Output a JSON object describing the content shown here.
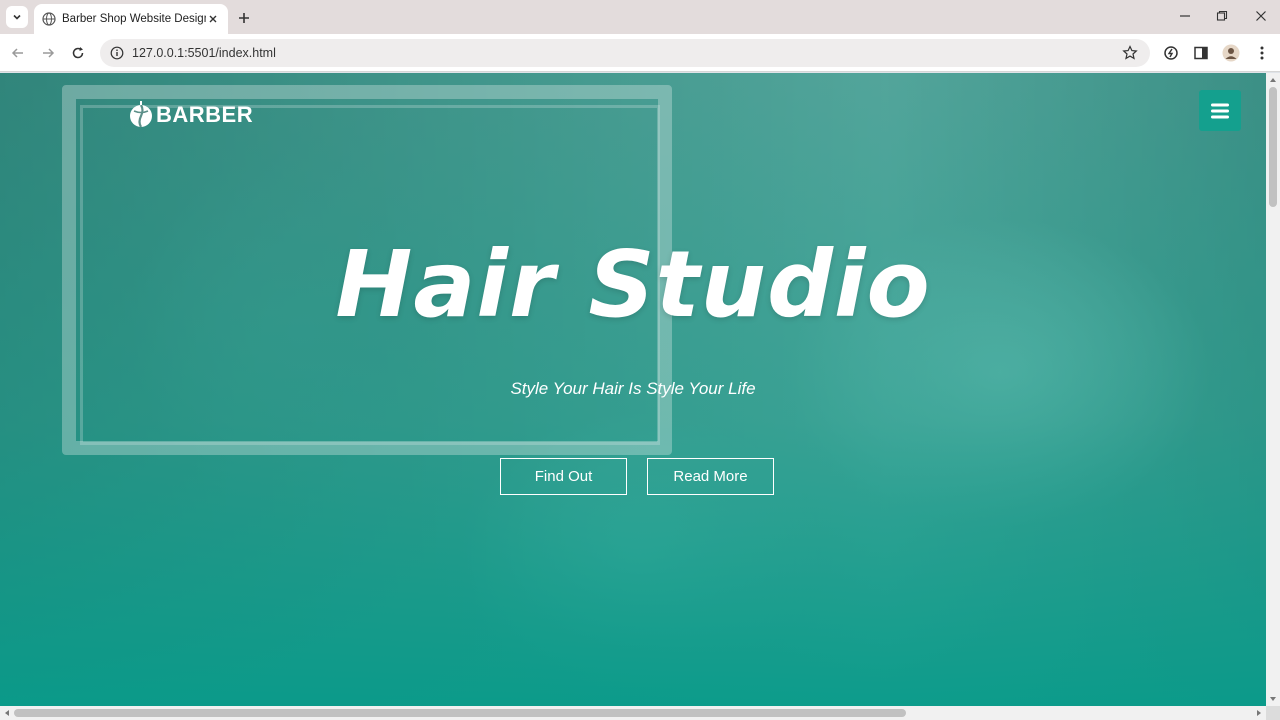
{
  "browser": {
    "tab": {
      "title": "Barber Shop Website Design",
      "favicon": "globe-icon"
    },
    "address_bar": {
      "url": "127.0.0.1:5501/index.html",
      "info_icon": "info-icon"
    },
    "icons": {
      "tab_list": "chevron-down-icon",
      "new_tab": "plus-icon",
      "minimize": "minimize-icon",
      "maximize": "restore-icon",
      "close": "close-icon",
      "back": "arrow-left-icon",
      "forward": "arrow-right-icon",
      "reload": "reload-icon",
      "bookmark": "star-icon",
      "extension": "extension-icon",
      "side_panel": "side-panel-icon",
      "profile": "profile-icon",
      "menu": "more-vert-icon"
    }
  },
  "page": {
    "logo": {
      "text": "BARBER",
      "icon": "barber-logo-icon"
    },
    "menu_button_icon": "hamburger-icon",
    "hero": {
      "title": "Hair Studio",
      "subtitle": "Style Your Hair Is Style Your Life",
      "buttons": [
        "Find Out",
        "Read More"
      ]
    },
    "colors": {
      "accent": "#14a08e",
      "overlay": "#089b8a",
      "text": "#ffffff"
    }
  }
}
